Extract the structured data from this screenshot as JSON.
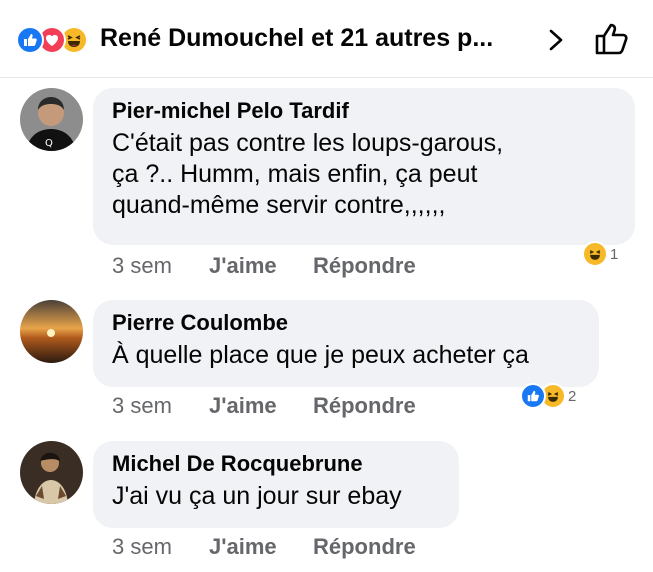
{
  "header": {
    "title": "René Dumouchel et 21 autres p...",
    "reactions": [
      "like-icon",
      "love-icon",
      "haha-icon"
    ]
  },
  "comments": [
    {
      "author": "Pier-michel Pelo Tardif",
      "lines": [
        "C'était pas contre les loups-garous,",
        "ça ?..   Humm, mais enfin, ça peut",
        "quand-même servir contre,,,,,,"
      ],
      "time": "3 sem",
      "like_label": "J'aime",
      "reply_label": "Répondre",
      "reaction_count": "1"
    },
    {
      "author": "Pierre Coulombe",
      "lines": [
        "À quelle place que je peux acheter ça"
      ],
      "time": "3 sem",
      "like_label": "J'aime",
      "reply_label": "Répondre",
      "reaction_count": "2"
    },
    {
      "author": "Michel De Rocquebrune",
      "lines": [
        "J'ai vu ça un jour sur ebay"
      ],
      "time": "3 sem",
      "like_label": "J'aime",
      "reply_label": "Répondre"
    }
  ],
  "colors": {
    "like": "#1877f2",
    "love": "#f33e58",
    "haha": "#f7b928",
    "bubble": "#f0f2f5",
    "meta": "#65676b"
  }
}
